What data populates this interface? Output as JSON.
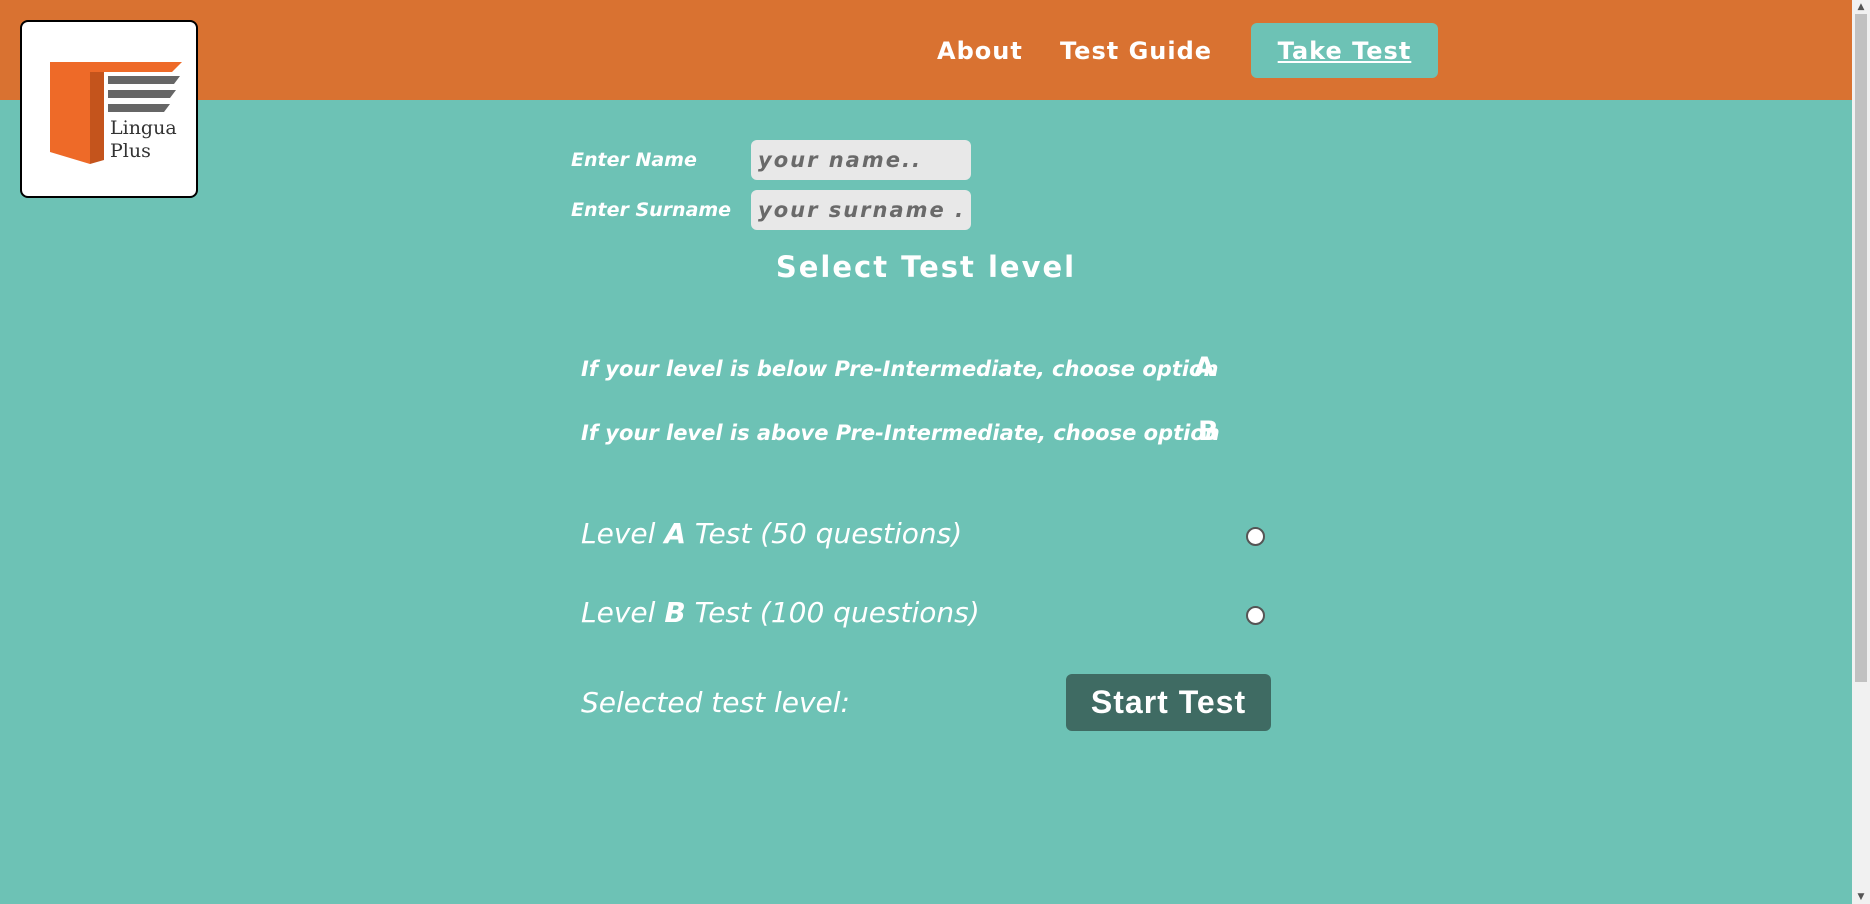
{
  "brand": {
    "logo_line1": "Lingua",
    "logo_line2": "Plus"
  },
  "nav": {
    "about": "About",
    "guide": "Test Guide",
    "take_test": "Take Test"
  },
  "form": {
    "name_label": "Enter Name",
    "name_placeholder": "your name..",
    "surname_label": "Enter Surname",
    "surname_placeholder": "your surname .."
  },
  "title": "Select Test level",
  "options": {
    "line_a": "If your level is below Pre-Intermediate, choose option",
    "letter_a": "A",
    "line_b": "If your level is above Pre-Intermediate, choose option",
    "letter_b": "B"
  },
  "levels": {
    "a_prefix": "Level",
    "a_letter": "A",
    "a_suffix": "Test (50 questions)",
    "b_prefix": "Level",
    "b_letter": "B",
    "b_suffix": "Test (100 questions)"
  },
  "selected_label": "Selected test level:",
  "start_button": "Start Test",
  "colors": {
    "header": "#d97231",
    "background": "#6dc2b5",
    "button": "#3f6b63",
    "logo_orange": "#ee6a28",
    "logo_gray": "#666666"
  }
}
